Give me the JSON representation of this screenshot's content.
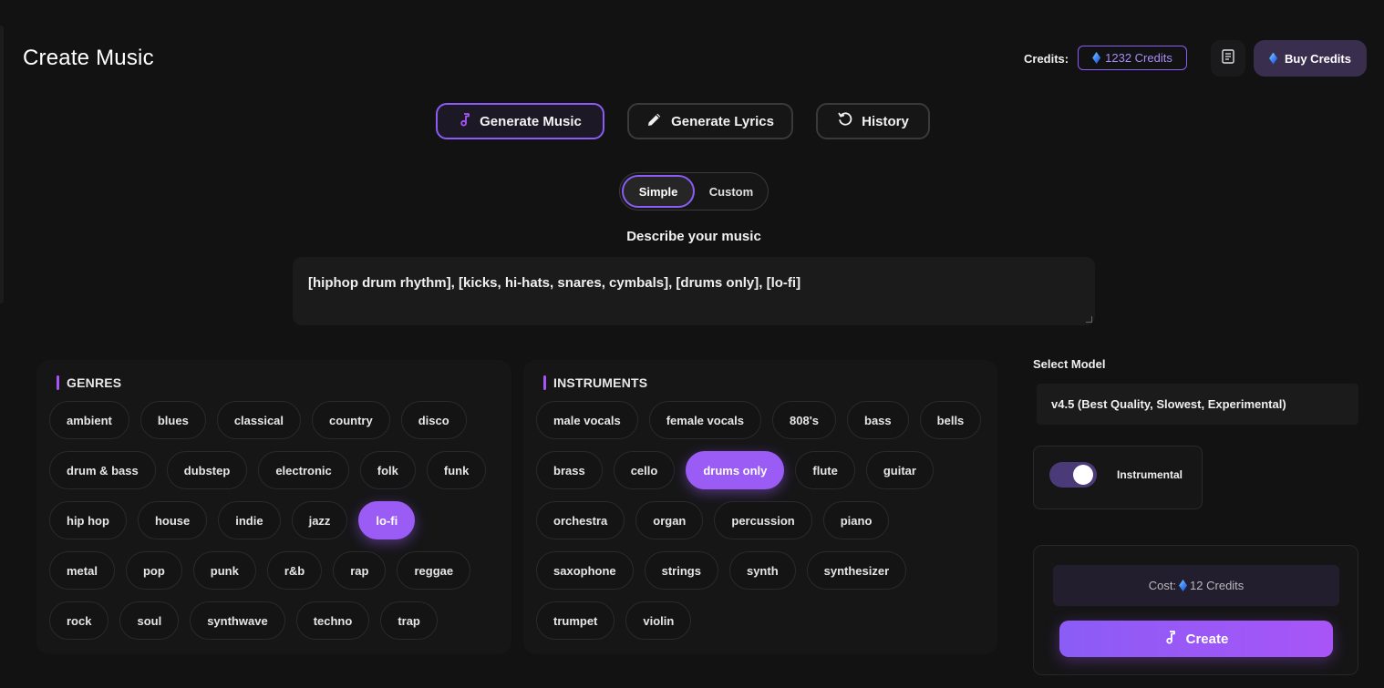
{
  "header": {
    "title": "Create Music",
    "credits_label": "Credits:",
    "credits_value": "1232 Credits",
    "buy_label": "Buy Credits",
    "accent_color": "#8b5cf6"
  },
  "tabs": [
    {
      "label": "Generate Music",
      "icon": "music-note-icon",
      "active": true
    },
    {
      "label": "Generate Lyrics",
      "icon": "pencil-icon",
      "active": false
    },
    {
      "label": "History",
      "icon": "history-icon",
      "active": false
    }
  ],
  "mode": {
    "simple": "Simple",
    "custom": "Custom",
    "selected": "Simple"
  },
  "describe": {
    "label": "Describe your music",
    "value": "[hiphop drum rhythm], [kicks, hi-hats, snares, cymbals], [drums only], [lo-fi]"
  },
  "genres": {
    "title": "GENRES",
    "rows": [
      [
        "ambient",
        "blues",
        "classical",
        "country",
        "disco"
      ],
      [
        "drum & bass",
        "dubstep",
        "electronic",
        "folk",
        "funk"
      ],
      [
        "hip hop",
        "house",
        "indie",
        "jazz",
        "lo-fi"
      ],
      [
        "metal",
        "pop",
        "punk",
        "r&b",
        "rap",
        "reggae"
      ],
      [
        "rock",
        "soul",
        "synthwave",
        "techno",
        "trap"
      ]
    ],
    "selected": [
      "lo-fi"
    ]
  },
  "instruments": {
    "title": "INSTRUMENTS",
    "rows": [
      [
        "male vocals",
        "female vocals",
        "808's",
        "bass",
        "bells"
      ],
      [
        "brass",
        "cello",
        "drums only",
        "flute",
        "guitar"
      ],
      [
        "orchestra",
        "organ",
        "percussion",
        "piano"
      ],
      [
        "saxophone",
        "strings",
        "synth",
        "synthesizer"
      ],
      [
        "trumpet",
        "violin"
      ]
    ],
    "selected": [
      "drums only"
    ]
  },
  "model": {
    "label": "Select Model",
    "value": "v4.5 (Best Quality, Slowest, Experimental)"
  },
  "instrumental": {
    "label": "Instrumental",
    "enabled": true
  },
  "cost": {
    "label": "Cost:",
    "value": "12 Credits"
  },
  "create": {
    "label": "Create",
    "icon": "music-note-icon"
  }
}
